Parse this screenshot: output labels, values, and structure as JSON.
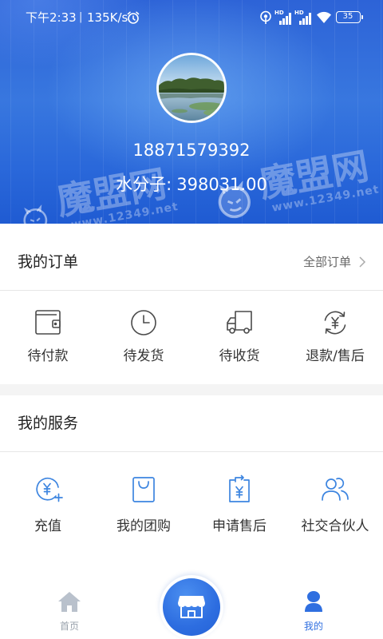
{
  "status_bar": {
    "time": "下午2:33",
    "separator": "|",
    "network_speed": "135K/s",
    "alarm_icon": "alarm-clock-icon",
    "hotspot_icon": "hotspot-icon",
    "sim1_tag": "HD",
    "sim2_tag": "HD",
    "wifi_icon": "wifi-icon",
    "battery_level": "35"
  },
  "profile": {
    "phone": "18871579392",
    "points_label": "水分子:",
    "points_value": "398031.00"
  },
  "watermark": {
    "brand": "魔盟网",
    "url": "www.12349.net"
  },
  "orders": {
    "title": "我的订单",
    "all_label": "全部订单",
    "items": [
      {
        "label": "待付款",
        "icon": "wallet-icon"
      },
      {
        "label": "待发货",
        "icon": "clock-icon"
      },
      {
        "label": "待收货",
        "icon": "truck-icon"
      },
      {
        "label": "退款/售后",
        "icon": "refund-icon"
      }
    ]
  },
  "services": {
    "title": "我的服务",
    "items": [
      {
        "label": "充值",
        "icon": "recharge-icon"
      },
      {
        "label": "我的团购",
        "icon": "shopping-bag-icon"
      },
      {
        "label": "申请售后",
        "icon": "after-sale-icon"
      },
      {
        "label": "社交合伙人",
        "icon": "partners-icon"
      }
    ]
  },
  "tab_bar": {
    "home_label": "首页",
    "home_icon": "home-icon",
    "center_icon": "store-icon",
    "mine_label": "我的",
    "mine_icon": "user-icon",
    "mine_active": true
  },
  "colors": {
    "accent": "#2f6fe0",
    "header_top": "#2d63d7",
    "header_bottom": "#1f5bd2",
    "order_icon": "#4a4a4a",
    "service_icon": "#3d85e0",
    "inactive_tab": "#b9c1cc",
    "section_gap": "#f4f4f4"
  }
}
